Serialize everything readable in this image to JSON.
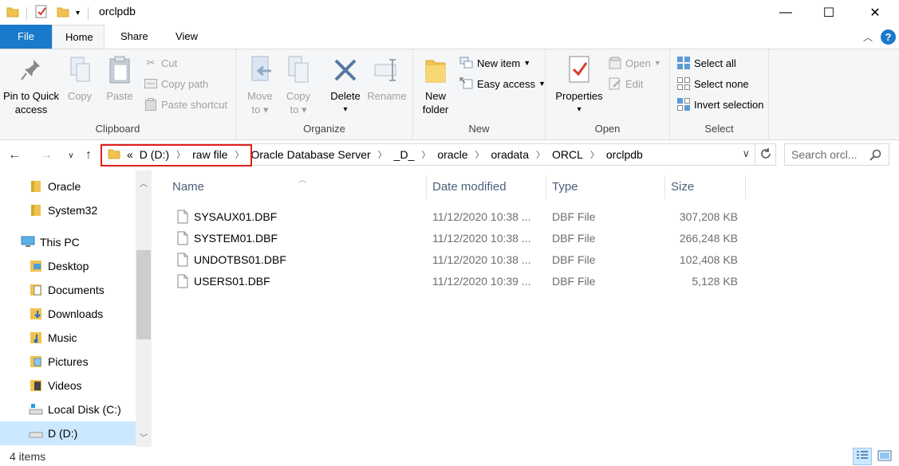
{
  "window": {
    "title": "orclpdb",
    "minimize_label": "—",
    "maximize_label": "☐",
    "close_label": "✕"
  },
  "ribbon_tabs": {
    "file": "File",
    "home": "Home",
    "share": "Share",
    "view": "View"
  },
  "clipboard": {
    "pin_line1": "Pin to Quick",
    "pin_line2": "access",
    "copy": "Copy",
    "paste": "Paste",
    "cut": "Cut",
    "copy_path": "Copy path",
    "paste_shortcut": "Paste shortcut",
    "label": "Clipboard"
  },
  "organize": {
    "move_to_line1": "Move",
    "move_to_line2": "to",
    "copy_to_line1": "Copy",
    "copy_to_line2": "to",
    "delete": "Delete",
    "rename": "Rename",
    "label": "Organize"
  },
  "new_group": {
    "new_folder_line1": "New",
    "new_folder_line2": "folder",
    "new_item": "New item",
    "easy_access": "Easy access",
    "label": "New"
  },
  "open_group": {
    "properties": "Properties",
    "open": "Open",
    "edit": "Edit",
    "label": "Open"
  },
  "select_group": {
    "select_all": "Select all",
    "select_none": "Select none",
    "invert_selection": "Invert selection",
    "label": "Select"
  },
  "address": {
    "overflow": "«",
    "crumbs": [
      "D (D:)",
      "raw file",
      "Oracle Database Server",
      "_D_",
      "oracle",
      "oradata",
      "ORCL",
      "orclpdb"
    ],
    "search_placeholder": "Search orcl..."
  },
  "nav_pane": {
    "items": [
      {
        "label": "Oracle"
      },
      {
        "label": "System32"
      },
      {
        "label": "This PC"
      },
      {
        "label": "Desktop"
      },
      {
        "label": "Documents"
      },
      {
        "label": "Downloads"
      },
      {
        "label": "Music"
      },
      {
        "label": "Pictures"
      },
      {
        "label": "Videos"
      },
      {
        "label": "Local Disk (C:)"
      },
      {
        "label": "D (D:)"
      }
    ]
  },
  "columns": {
    "name": "Name",
    "date": "Date modified",
    "type": "Type",
    "size": "Size"
  },
  "files": [
    {
      "name": "SYSAUX01.DBF",
      "date": "11/12/2020 10:38 ...",
      "type": "DBF File",
      "size": "307,208 KB"
    },
    {
      "name": "SYSTEM01.DBF",
      "date": "11/12/2020 10:38 ...",
      "type": "DBF File",
      "size": "266,248 KB"
    },
    {
      "name": "UNDOTBS01.DBF",
      "date": "11/12/2020 10:38 ...",
      "type": "DBF File",
      "size": "102,408 KB"
    },
    {
      "name": "USERS01.DBF",
      "date": "11/12/2020 10:39 ...",
      "type": "DBF File",
      "size": "5,128 KB"
    }
  ],
  "status": {
    "count": "4 items"
  },
  "colors": {
    "file_tab": "#1979ca",
    "folder": "#f0c34e",
    "highlight": "#e0201b",
    "selected": "#cce8ff"
  }
}
